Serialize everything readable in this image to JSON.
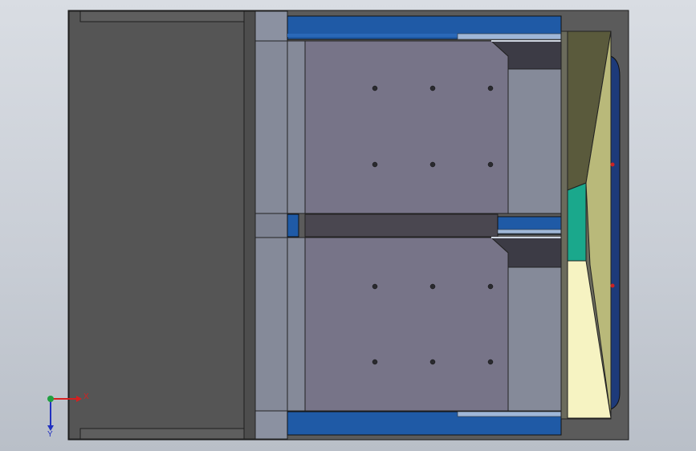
{
  "viewport": {
    "background_top": "#d9dde3",
    "background_bottom": "#b9bfc8"
  },
  "colors": {
    "frame": "#575757",
    "panel_dark": "#4f4f4f",
    "steel": "#858b9c",
    "plate": "#777488",
    "blue": "#1f5aa6",
    "rail": "#8fa7c8",
    "dark_block": "#4a4750",
    "olive": "#5a5a3c",
    "khaki": "#b9b97a",
    "teal": "#1aa88c",
    "pale_yellow": "#f6f3c2",
    "navy": "#1d3a7a",
    "red_dot": "#cc2222"
  },
  "triad": {
    "x_label": "X",
    "y_label": "Y",
    "x_color": "#d62020",
    "y_color": "#2030c0",
    "origin_color": "#20a040"
  }
}
